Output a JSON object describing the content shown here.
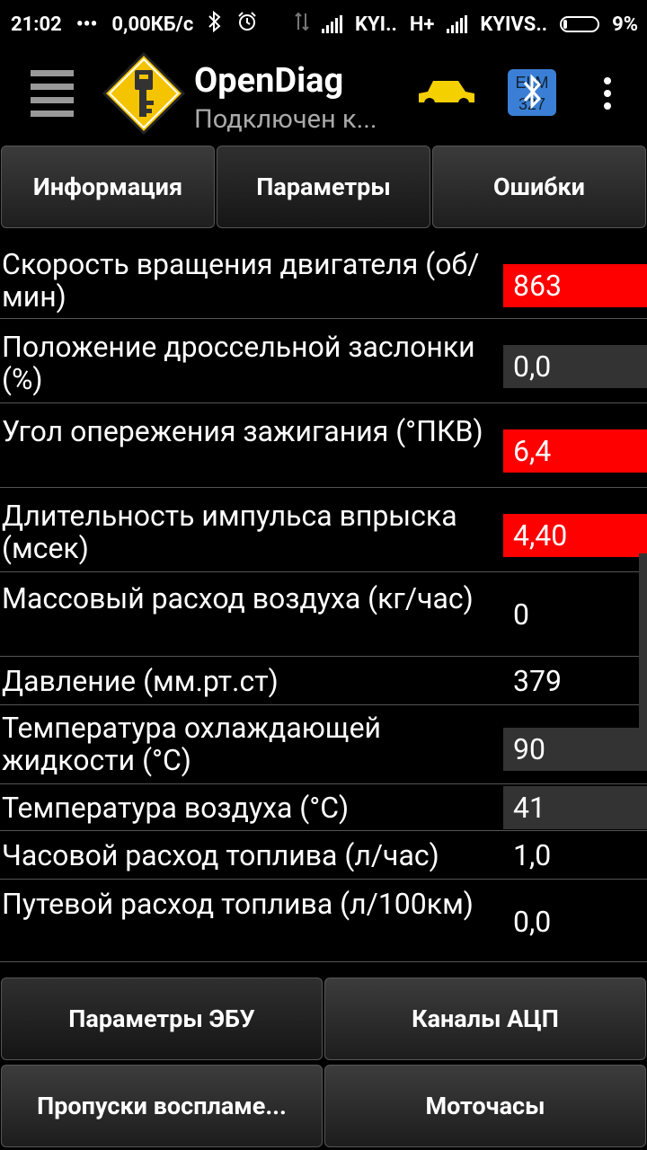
{
  "status_bar": {
    "time": "21:02",
    "dots": "•••",
    "speed": "0,00КБ/с",
    "carrier1": "KYI..",
    "network": "H+",
    "carrier2": "KYIVS..",
    "battery": "9%",
    "icons": [
      "bluetooth-icon",
      "alarm-icon",
      "data-icon",
      "signal-icon",
      "signal-icon",
      "battery-icon"
    ]
  },
  "app_bar": {
    "title": "OpenDiag",
    "subtitle": "Подключен к...",
    "icons": [
      "menu-icon",
      "key-logo-icon",
      "car-icon",
      "bluetooth-elm-icon",
      "more-icon"
    ],
    "colors": {
      "logo_yellow": "#F5C400",
      "car_yellow": "#F5D000",
      "bt_blue": "#3A7FD5"
    }
  },
  "tabs": [
    {
      "label": "Информация"
    },
    {
      "label": "Параметры",
      "selected": true
    },
    {
      "label": "Ошибки"
    }
  ],
  "params": [
    {
      "label": "Скорость вращения двигателя (об/мин)",
      "value": "863",
      "style": "red"
    },
    {
      "label": "Положение дроссельной заслонки (%)",
      "value": "0,0",
      "style": "gray"
    },
    {
      "label": "Угол опережения зажигания (°ПКВ)",
      "value": "6,4",
      "style": "red"
    },
    {
      "label": "Длительность импульса впрыска (мсек)",
      "value": "4,40",
      "style": "red"
    },
    {
      "label": "Массовый расход воздуха (кг/час)",
      "value": "0",
      "style": "none"
    },
    {
      "label": "Давление (мм.рт.ст)",
      "value": "379",
      "style": "none"
    },
    {
      "label": "Температура охлаждающей жидкости (°C)",
      "value": "90",
      "style": "gray"
    },
    {
      "label": "Температура воздуха (°C)",
      "value": "41",
      "style": "gray"
    },
    {
      "label": "Часовой расход топлива (л/час)",
      "value": "1,0",
      "style": "none"
    },
    {
      "label": "Путевой расход топлива (л/100км)",
      "value": "0,0",
      "style": "none"
    }
  ],
  "buttons": [
    {
      "label": "Параметры ЭБУ"
    },
    {
      "label": "Каналы АЦП"
    },
    {
      "label": "Пропуски воспламе..."
    },
    {
      "label": "Моточасы"
    }
  ],
  "colors": {
    "red_value": "#FF0000",
    "gray_value": "#333333",
    "background": "#000000"
  }
}
